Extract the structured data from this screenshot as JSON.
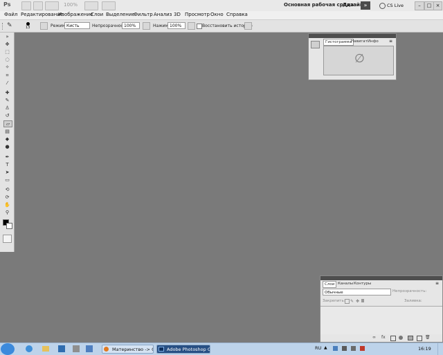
{
  "app": {
    "logo": "Ps",
    "zoom": "100%",
    "workspace": "Основная рабочая среда",
    "design": "Дизайн",
    "expand_glyph": "»",
    "cs_live": "CS Live",
    "window_controls": [
      "–",
      "□",
      "×"
    ]
  },
  "menu": [
    "Файл",
    "Редактирование",
    "Изображение",
    "Слои",
    "Выделение",
    "Фильтр",
    "Анализ",
    "3D",
    "Просмотр",
    "Окно",
    "Справка"
  ],
  "options": {
    "brush_size": "13",
    "mode_label": "Режим:",
    "mode_value": "Кисть",
    "opacity_label": "Непрозрачность:",
    "opacity_value": "100%",
    "pressure_label": "Нажим:",
    "pressure_value": "100%",
    "history_label": "Восстановить историю"
  },
  "nav_panel": {
    "tabs": [
      "Гистограмма",
      "Навигат",
      "Инфо"
    ],
    "empty_glyph": "∅"
  },
  "layers_panel": {
    "tabs": [
      "Слои",
      "Каналы",
      "Контуры"
    ],
    "blend_mode": "Обычные",
    "opacity_label": "Непрозрачность:",
    "lock_label": "Закрепить:",
    "fill_label": "Заливка:",
    "footer_icons": [
      "fx"
    ]
  },
  "taskbar": {
    "tasks": [
      "Материнство -> От...",
      "Adobe Photoshop C..."
    ],
    "lang": "RU",
    "time": "16:19"
  },
  "colors": {
    "canvas": "#7a7a7a",
    "taskbar": "#bdd3ea",
    "active_task": "#274f84"
  }
}
